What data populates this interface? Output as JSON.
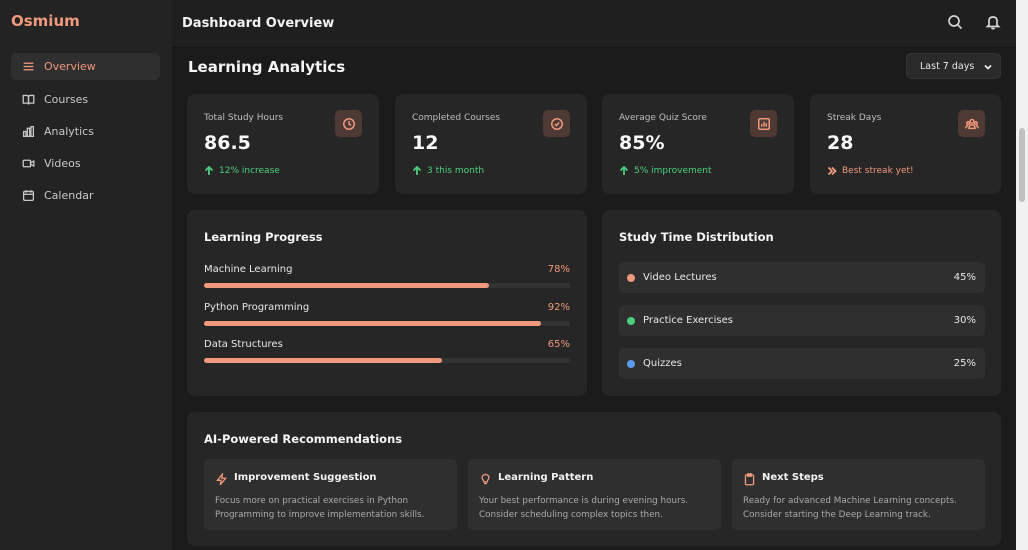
{
  "app": {
    "logo": "Osmium"
  },
  "sidebar": {
    "items": [
      {
        "label": "Overview",
        "icon": "menu-icon",
        "active": true
      },
      {
        "label": "Courses",
        "icon": "book-icon",
        "active": false
      },
      {
        "label": "Analytics",
        "icon": "bar-chart-icon",
        "active": false
      },
      {
        "label": "Videos",
        "icon": "video-icon",
        "active": false
      },
      {
        "label": "Calendar",
        "icon": "calendar-icon",
        "active": false
      }
    ]
  },
  "header": {
    "title": "Dashboard Overview",
    "icons": [
      "search-icon",
      "bell-icon"
    ]
  },
  "main": {
    "section_title": "Learning Analytics",
    "range_select": {
      "selected": "Last 7 days"
    },
    "stats": [
      {
        "label": "Total Study Hours",
        "value": "86.5",
        "sub": "12% increase",
        "icon": "clock-icon",
        "sub_icon": "arrow-up-icon"
      },
      {
        "label": "Completed Courses",
        "value": "12",
        "sub": "3 this month",
        "icon": "check-circle-icon",
        "sub_icon": "arrow-up-icon"
      },
      {
        "label": "Average Quiz Score",
        "value": "85%",
        "sub": "5% improvement",
        "icon": "bar-chart-icon",
        "sub_icon": "arrow-up-icon"
      },
      {
        "label": "Streak Days",
        "value": "28",
        "sub": "Best streak yet!",
        "icon": "users-icon",
        "sub_icon": "double-chevron-right-icon"
      }
    ],
    "progress": {
      "title": "Learning Progress",
      "items": [
        {
          "label": "Machine Learning",
          "pct": "78%",
          "value": 0.78
        },
        {
          "label": "Python Programming",
          "pct": "92%",
          "value": 0.92
        },
        {
          "label": "Data Structures",
          "pct": "65%",
          "value": 0.65
        }
      ]
    },
    "distribution": {
      "title": "Study Time Distribution",
      "items": [
        {
          "label": "Video Lectures",
          "pct": "45%",
          "color": "#f0997d"
        },
        {
          "label": "Practice Exercises",
          "pct": "30%",
          "color": "#4ccf7c"
        },
        {
          "label": "Quizzes",
          "pct": "25%",
          "color": "#5b9bf0"
        }
      ]
    },
    "recommendations": {
      "title": "AI-Powered Recommendations",
      "items": [
        {
          "title": "Improvement Suggestion",
          "icon": "lightning-icon",
          "text": "Focus more on practical exercises in Python Programming to improve implementation skills."
        },
        {
          "title": "Learning Pattern",
          "icon": "lightbulb-icon",
          "text": "Your best performance is during evening hours. Consider scheduling complex topics then."
        },
        {
          "title": "Next Steps",
          "icon": "clipboard-icon",
          "text": "Ready for advanced Machine Learning concepts. Consider starting the Deep Learning track."
        }
      ]
    }
  },
  "colors": {
    "accent": "#f0997d",
    "positive": "#4ccf7c",
    "background": "#1b1b1b",
    "card": "#262626"
  }
}
